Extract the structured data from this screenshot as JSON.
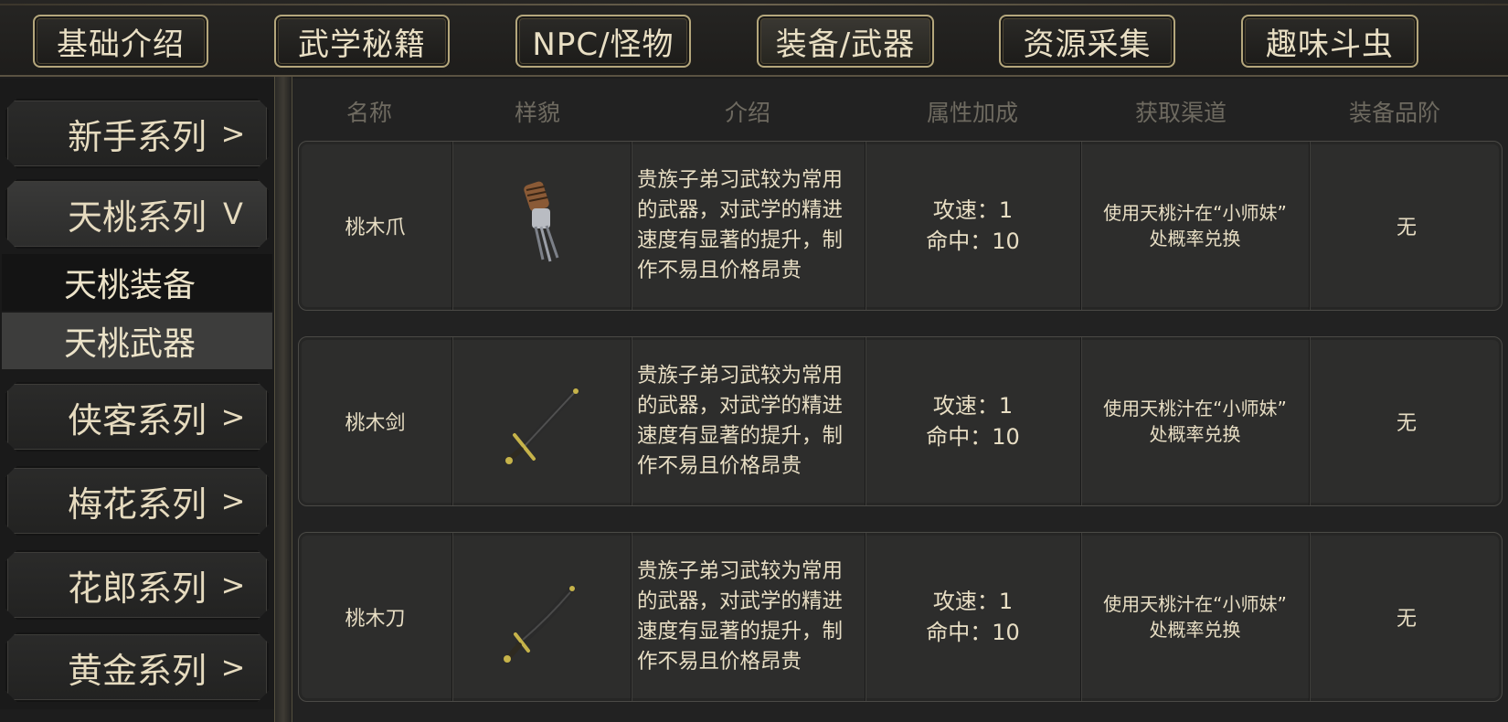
{
  "tabs": [
    {
      "label": "基础介绍"
    },
    {
      "label": "武学秘籍"
    },
    {
      "label": "NPC/怪物"
    },
    {
      "label": "装备/武器",
      "active": true
    },
    {
      "label": "资源采集"
    },
    {
      "label": "趣味斗虫"
    }
  ],
  "sidebar": {
    "categories": [
      {
        "label": "新手系列",
        "chevron": ">"
      },
      {
        "label": "天桃系列",
        "chevron": "V",
        "open": true
      },
      {
        "label": "侠客系列",
        "chevron": ">"
      },
      {
        "label": "梅花系列",
        "chevron": ">"
      },
      {
        "label": "花郎系列",
        "chevron": ">"
      },
      {
        "label": "黄金系列",
        "chevron": ">"
      }
    ],
    "subitems": [
      {
        "label": "天桃装备"
      },
      {
        "label": "天桃武器",
        "selected": true
      }
    ]
  },
  "table": {
    "headers": [
      "名称",
      "样貌",
      "介绍",
      "属性加成",
      "获取渠道",
      "装备品阶"
    ],
    "rows": [
      {
        "name": "桃木爪",
        "icon": "claw-weapon-icon",
        "desc": [
          "贵族子弟习武较为常用",
          "的武器，对武学的精进",
          "速度有显著的提升，制",
          "作不易且价格昂贵"
        ],
        "attrs": [
          "攻速：1",
          "命中：10"
        ],
        "source": [
          "使用天桃汁在“小师妹”",
          "处概率兑换"
        ],
        "grade": "无"
      },
      {
        "name": "桃木剑",
        "icon": "sword-weapon-icon",
        "desc": [
          "贵族子弟习武较为常用",
          "的武器，对武学的精进",
          "速度有显著的提升，制",
          "作不易且价格昂贵"
        ],
        "attrs": [
          "攻速：1",
          "命中：10"
        ],
        "source": [
          "使用天桃汁在“小师妹”",
          "处概率兑换"
        ],
        "grade": "无"
      },
      {
        "name": "桃木刀",
        "icon": "saber-weapon-icon",
        "desc": [
          "贵族子弟习武较为常用",
          "的武器，对武学的精进",
          "速度有显著的提升，制",
          "作不易且价格昂贵"
        ],
        "attrs": [
          "攻速：1",
          "命中：10"
        ],
        "source": [
          "使用天桃汁在“小师妹”",
          "处概率兑换"
        ],
        "grade": "无"
      }
    ]
  },
  "colors": {
    "gold_border": "#b5a77c",
    "text": "#e8dec4",
    "header_text": "#6e6a60"
  }
}
